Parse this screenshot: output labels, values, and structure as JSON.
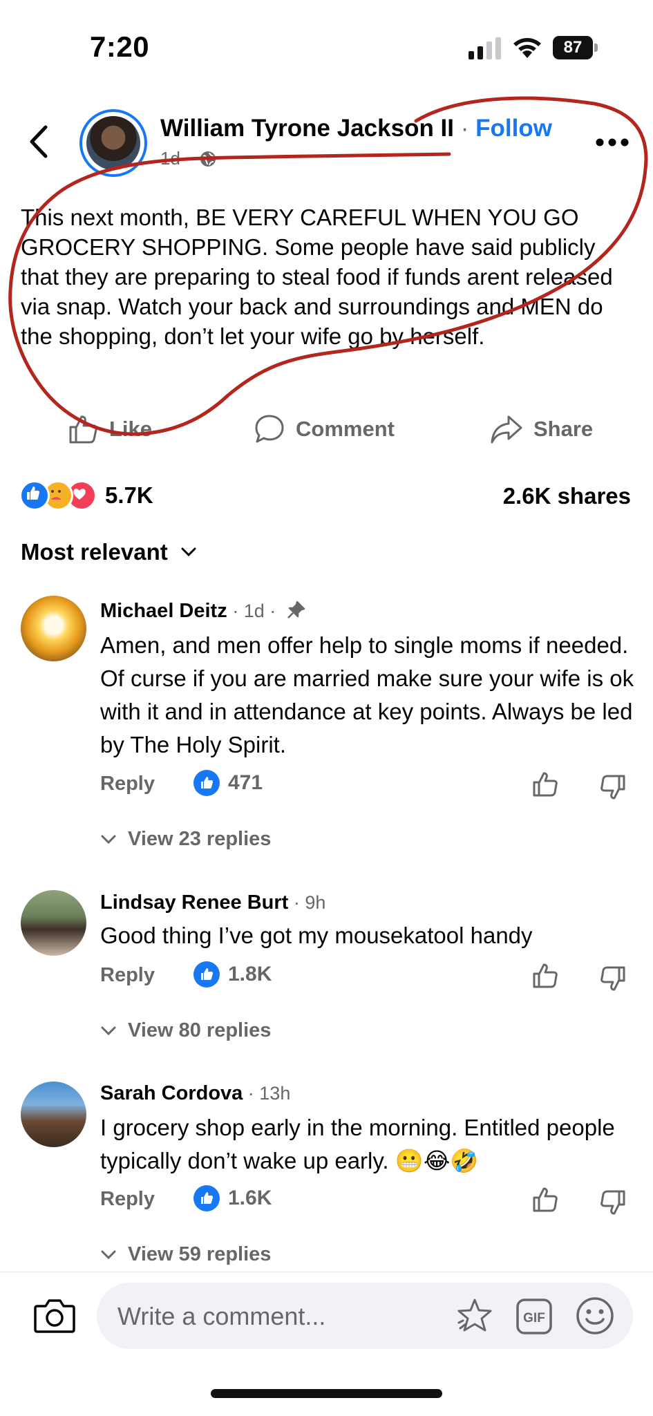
{
  "status_bar": {
    "time": "7:20",
    "battery": "87"
  },
  "post": {
    "author": "William Tyrone Jackson II",
    "separator": " · ",
    "follow_label": "Follow",
    "time": "1d ·",
    "text": "This next month, BE VERY CAREFUL WHEN YOU GO GROCERY SHOPPING. Some people have said publicly that they are preparing to steal food if funds arent released via snap. Watch your back and surroundings and MEN do the shopping, don’t let your wife go by herself.",
    "actions": {
      "like": "Like",
      "comment": "Comment",
      "share": "Share"
    },
    "reaction_count": "5.7K",
    "shares": "2.6K shares",
    "colors": {
      "accent": "#1877f2",
      "annotation": "#b3261e",
      "muted": "#65676b"
    }
  },
  "sort_label": "Most relevant",
  "comments": [
    {
      "name": "Michael Deitz",
      "meta": " · 1d ·",
      "text": "Amen, and men offer help to single moms if needed. Of curse if you are married make sure your wife is ok with it and in attendance at key points. Always be led by The Holy Spirit.",
      "reply": "Reply",
      "likes": "471",
      "view_replies": "View 23 replies",
      "pinned_icon": "pin-icon"
    },
    {
      "name": "Lindsay Renee Burt",
      "meta": " · 9h",
      "text": "Good thing I’ve got my mousekatool handy",
      "reply": "Reply",
      "likes": "1.8K",
      "view_replies": "View 80 replies"
    },
    {
      "name": "Sarah Cordova",
      "meta": " · 13h",
      "text": "I grocery shop early in the morning. Entitled people typically don’t wake up early.",
      "emojis": "😬😂🤣",
      "reply": "Reply",
      "likes": "1.6K",
      "view_replies": "View 59 replies"
    }
  ],
  "composer": {
    "placeholder": "Write a comment..."
  }
}
